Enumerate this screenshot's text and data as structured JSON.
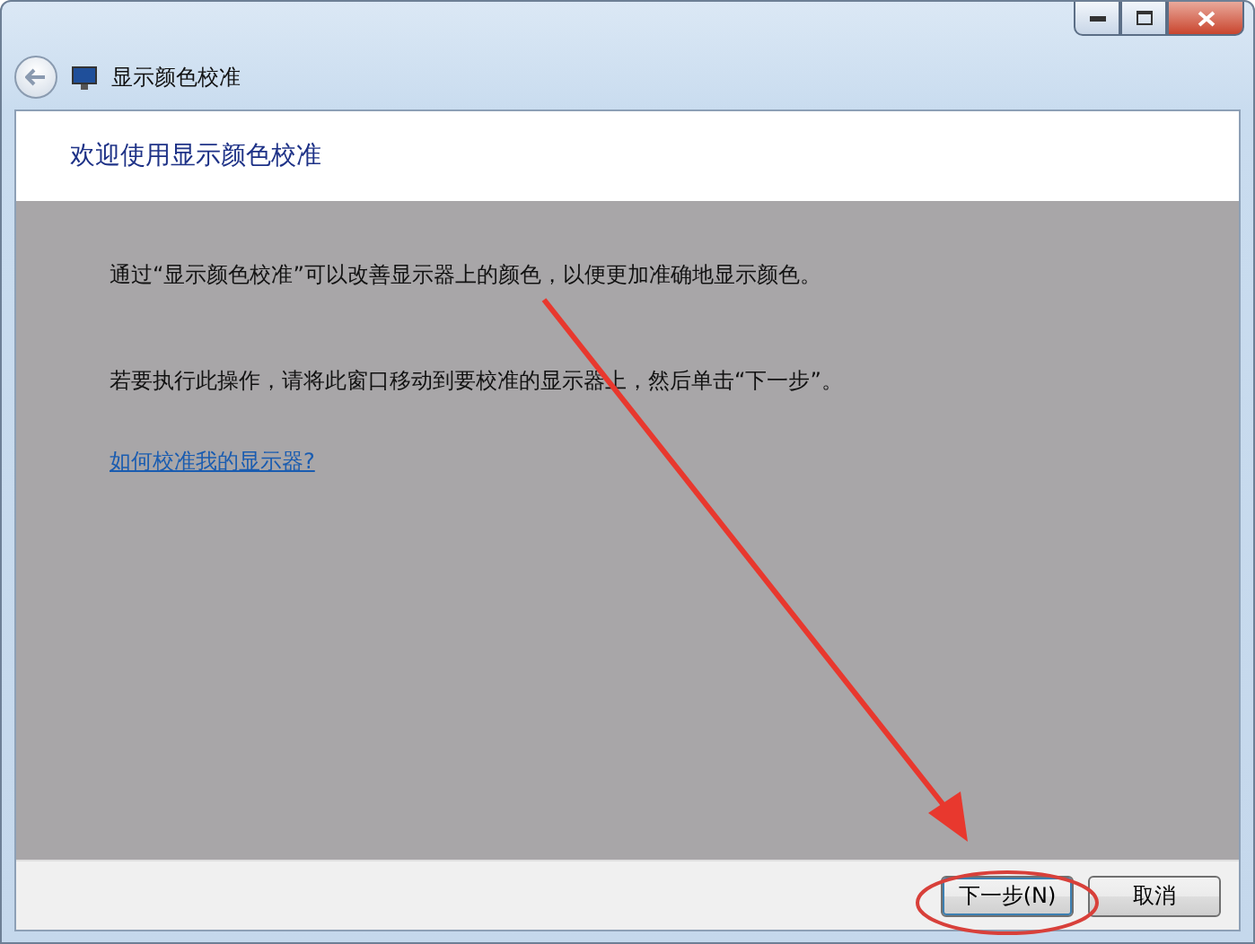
{
  "window": {
    "title": "显示颜色校准"
  },
  "header": {
    "title": "欢迎使用显示颜色校准"
  },
  "body": {
    "paragraphs": [
      "通过“显示颜色校准”可以改善显示器上的颜色，以便更加准确地显示颜色。",
      "若要执行此操作，请将此窗口移动到要校准的显示器上，然后单击“下一步”。"
    ],
    "link": "如何校准我的显示器?"
  },
  "buttons": [
    {
      "label": "下一步(N)"
    },
    {
      "label": "取消"
    }
  ]
}
